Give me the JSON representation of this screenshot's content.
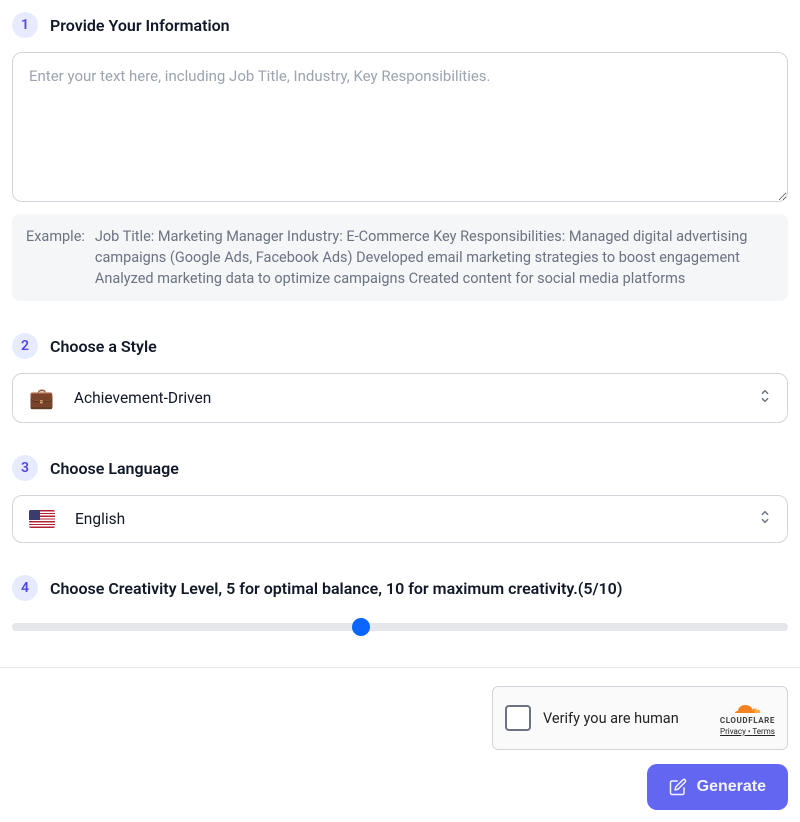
{
  "step1": {
    "num": "1",
    "title": "Provide Your Information",
    "placeholder": "Enter your text here, including Job Title, Industry, Key Responsibilities.",
    "value": "",
    "example_label": "Example:",
    "example_text": "Job Title: Marketing Manager Industry: E-Commerce Key Responsibilities: Managed digital advertising campaigns (Google Ads, Facebook Ads) Developed email marketing strategies to boost engagement Analyzed marketing data to optimize campaigns Created content for social media platforms"
  },
  "step2": {
    "num": "2",
    "title": "Choose a Style",
    "emoji": "💼",
    "selected": "Achievement-Driven"
  },
  "step3": {
    "num": "3",
    "title": "Choose Language",
    "selected": "English"
  },
  "step4": {
    "num": "4",
    "title": "Choose Creativity Level, 5 for optimal balance, 10 for maximum creativity.(5/10)",
    "value": 5,
    "min": 0,
    "max": 10
  },
  "captcha": {
    "label": "Verify you are human",
    "brand": "CLOUDFLARE",
    "privacy": "Privacy",
    "terms": "Terms",
    "sep": " • "
  },
  "generate": {
    "label": "Generate"
  }
}
